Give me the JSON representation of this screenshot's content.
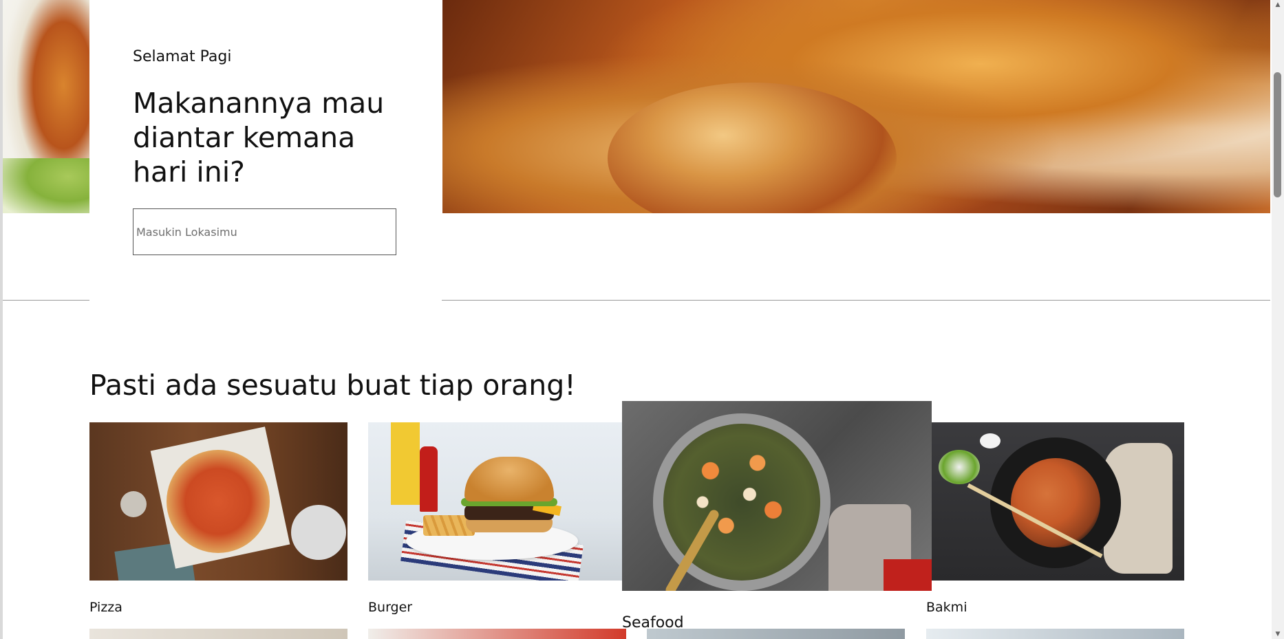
{
  "hero": {
    "greeting": "Selamat Pagi",
    "headline": "Makanannya mau diantar kemana hari ini?",
    "location_placeholder": "Masukin Lokasimu",
    "location_value": ""
  },
  "categories": {
    "title": "Pasti ada sesuatu buat tiap orang!",
    "items": [
      {
        "label": "Pizza"
      },
      {
        "label": "Burger"
      },
      {
        "label": "Seafood"
      },
      {
        "label": "Bakmi"
      }
    ]
  },
  "icons": {
    "scroll_up": "scroll-up-arrow-icon",
    "scroll_down": "scroll-down-arrow-icon"
  }
}
